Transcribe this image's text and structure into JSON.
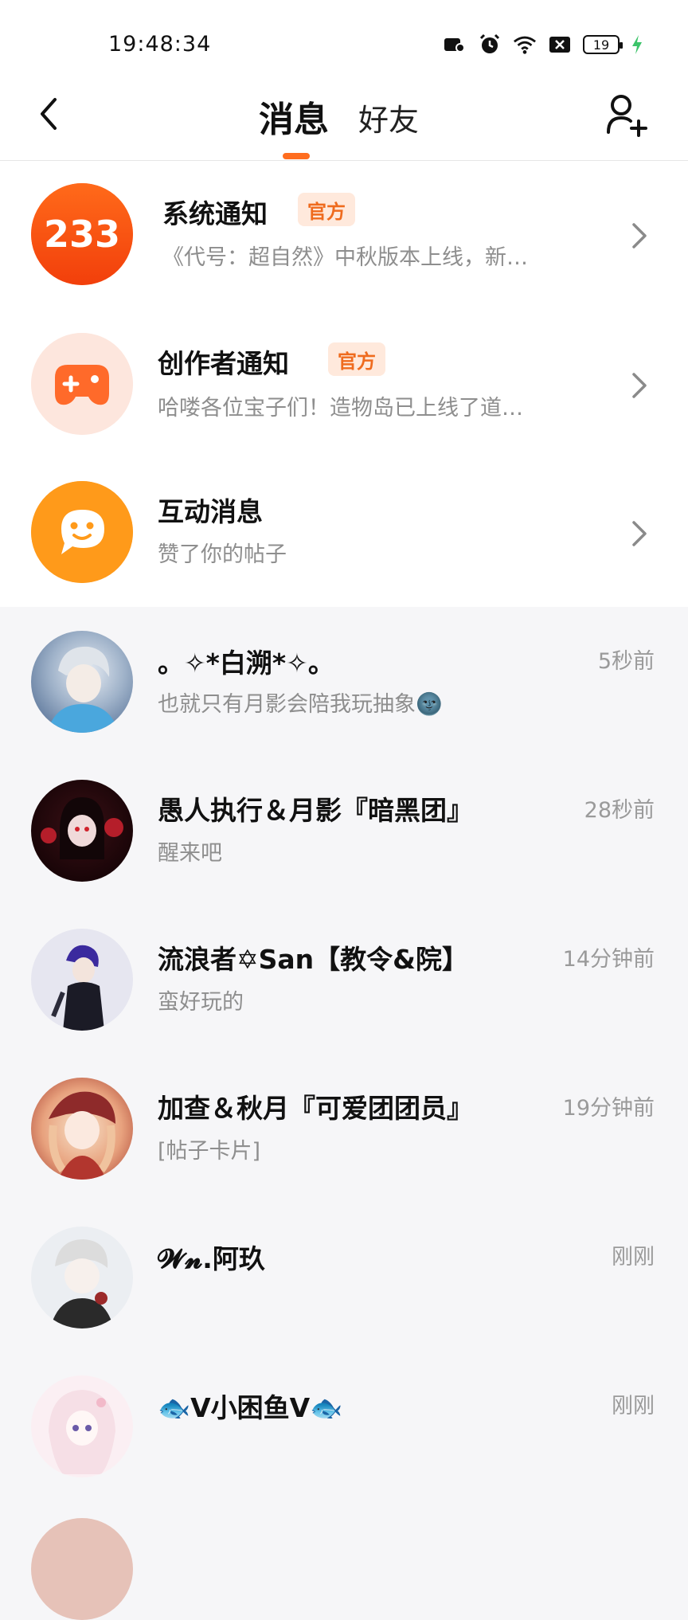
{
  "status_bar": {
    "time": "19:48:34",
    "battery": "19"
  },
  "header": {
    "tab_active": "消息",
    "tab_inactive": "好友"
  },
  "official": [
    {
      "name": "系统通知",
      "badge": "官方",
      "preview": "《代号：超自然》中秋版本上线，新…",
      "avatar_text": "233",
      "avatar_color": "#ff5a16"
    },
    {
      "name": "创作者通知",
      "badge": "官方",
      "preview": "哈喽各位宝子们！造物岛已上线了道…",
      "avatar_color": "#ff6a2a"
    },
    {
      "name": "互动消息",
      "preview": "赞了你的帖子",
      "avatar_color": "#ff9a1a"
    }
  ],
  "chats": [
    {
      "name": "。✧*白溯*✧。",
      "time": "5秒前",
      "preview": "也就只有月影会陪我玩抽象🌚"
    },
    {
      "name": "愚人执行＆月影『暗黑团』",
      "time": "28秒前",
      "preview": "醒来吧"
    },
    {
      "name": "流浪者✡San【教令&院】",
      "time": "14分钟前",
      "preview": "蛮好玩的"
    },
    {
      "name": "加查＆秋月『可爱团团员』",
      "time": "19分钟前",
      "preview": "[帖子卡片]"
    },
    {
      "name": "𝓦𝓷.阿玖",
      "time": "刚刚",
      "preview": ""
    },
    {
      "name": "🐟V小困鱼V🐟",
      "time": "刚刚",
      "preview": ""
    }
  ],
  "colors": {
    "accent": "#ff6d1f",
    "badge_bg": "#ffe9dc",
    "badge_text": "#ef6b1e"
  }
}
